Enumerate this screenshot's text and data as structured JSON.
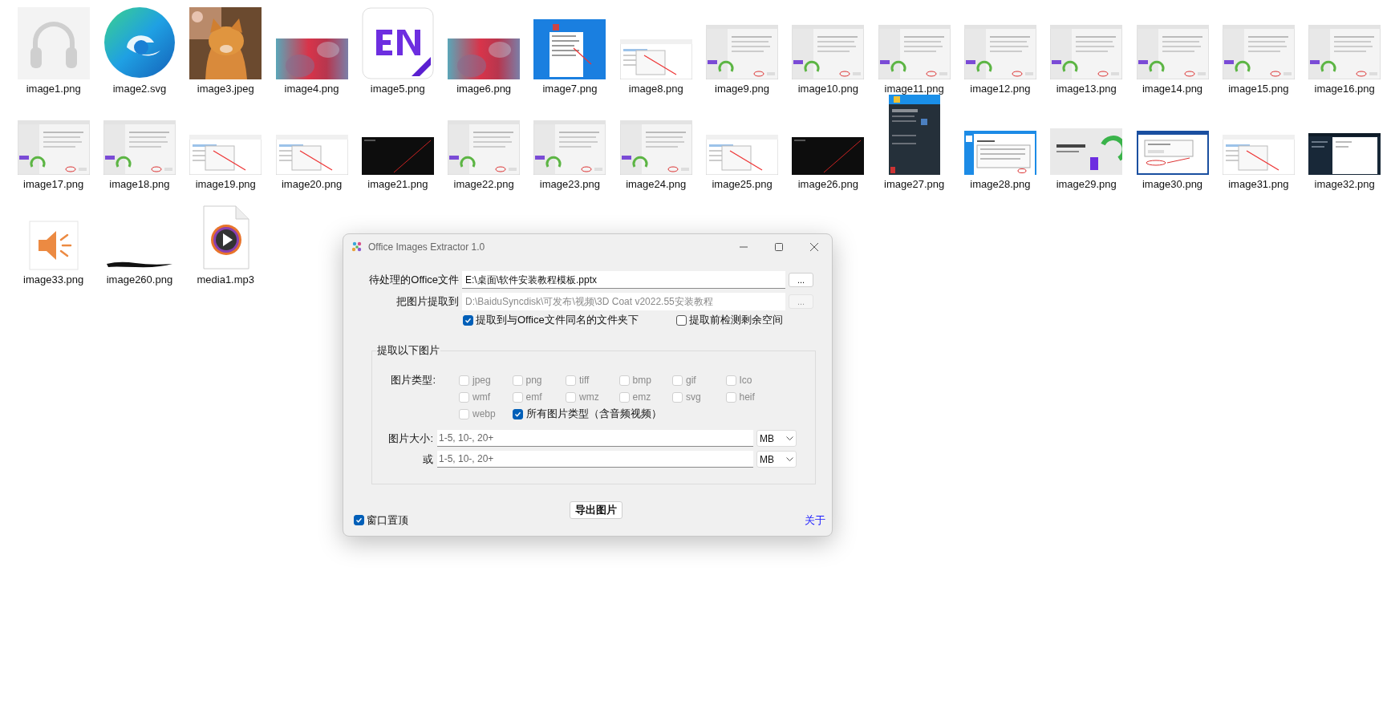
{
  "files": [
    {
      "name": "image1.png",
      "kind": "audio"
    },
    {
      "name": "image2.svg",
      "kind": "swirl"
    },
    {
      "name": "image3.jpeg"
    },
    {
      "name": "image4.png",
      "kind": "gradient"
    },
    {
      "name": "image5.png",
      "kind": "logo"
    },
    {
      "name": "image6.png",
      "kind": "gradient"
    },
    {
      "name": "image7.png",
      "kind": "desktop"
    },
    {
      "name": "image8.png",
      "kind": "explorer"
    },
    {
      "name": "image9.png",
      "kind": "installer"
    },
    {
      "name": "image10.png",
      "kind": "installer"
    },
    {
      "name": "image11.png",
      "kind": "installer"
    },
    {
      "name": "image12.png",
      "kind": "installer"
    },
    {
      "name": "image13.png",
      "kind": "installer"
    },
    {
      "name": "image14.png",
      "kind": "installer"
    },
    {
      "name": "image15.png",
      "kind": "installer"
    },
    {
      "name": "image16.png",
      "kind": "installer"
    },
    {
      "name": "image17.png",
      "kind": "installer"
    },
    {
      "name": "image18.png",
      "kind": "installer"
    },
    {
      "name": "image19.png",
      "kind": "explorer"
    },
    {
      "name": "image20.png",
      "kind": "explorer"
    },
    {
      "name": "image21.png",
      "kind": "dark"
    },
    {
      "name": "image22.png",
      "kind": "installer"
    },
    {
      "name": "image23.png",
      "kind": "installer"
    },
    {
      "name": "image24.png",
      "kind": "installer"
    },
    {
      "name": "image25.png",
      "kind": "explorer"
    },
    {
      "name": "image26.png",
      "kind": "dark"
    },
    {
      "name": "image27.png",
      "kind": "darkapp"
    },
    {
      "name": "image28.png",
      "kind": "bluedialog"
    },
    {
      "name": "image29.png",
      "kind": "splash"
    },
    {
      "name": "image30.png",
      "kind": "bluewindow"
    },
    {
      "name": "image31.png",
      "kind": "explorer"
    },
    {
      "name": "image32.png",
      "kind": "darkwindow"
    },
    {
      "name": "image33.png",
      "kind": "speaker"
    },
    {
      "name": "image260.png",
      "kind": "scribble"
    },
    {
      "name": "media1.mp3",
      "kind": "media"
    }
  ],
  "dialog": {
    "title": "Office Images Extractor 1.0",
    "source": {
      "label": "待处理的Office文件",
      "value": "E:\\桌面\\软件安装教程模板.pptx",
      "browse": "...",
      "disabled": false
    },
    "target": {
      "label": "把图片提取到",
      "value": "D:\\BaiduSyncdisk\\可发布\\视频\\3D Coat v2022.55安装教程",
      "browse": "...",
      "disabled": true
    },
    "options": [
      {
        "label": "提取到与Office文件同名的文件夹下",
        "checked": true
      },
      {
        "label": "提取前检测剩余空间",
        "checked": false
      }
    ],
    "group": {
      "title": "提取以下图片",
      "types_label": "图片类型:",
      "types": [
        {
          "label": "jpeg",
          "checked": false,
          "disabled": true
        },
        {
          "label": "png",
          "checked": false,
          "disabled": true
        },
        {
          "label": "tiff",
          "checked": false,
          "disabled": true
        },
        {
          "label": "bmp",
          "checked": false,
          "disabled": true
        },
        {
          "label": "gif",
          "checked": false,
          "disabled": true
        },
        {
          "label": "Ico",
          "checked": false,
          "disabled": true
        },
        {
          "label": "wmf",
          "checked": false,
          "disabled": true
        },
        {
          "label": "emf",
          "checked": false,
          "disabled": true
        },
        {
          "label": "wmz",
          "checked": false,
          "disabled": true
        },
        {
          "label": "emz",
          "checked": false,
          "disabled": true
        },
        {
          "label": "svg",
          "checked": false,
          "disabled": true
        },
        {
          "label": "heif",
          "checked": false,
          "disabled": true
        },
        {
          "label": "webp",
          "checked": false,
          "disabled": true
        },
        {
          "label": "所有图片类型（含音频视频）",
          "checked": true,
          "disabled": false
        }
      ],
      "sizes": [
        {
          "label": "图片大小:",
          "placeholder": "1-5, 10-, 20+",
          "unit": "MB"
        },
        {
          "label": "或",
          "placeholder": "1-5, 10-, 20+",
          "unit": "MB"
        }
      ]
    },
    "export_button": "导出图片",
    "topmost": {
      "label": "窗口置顶",
      "checked": true
    },
    "about_link": "关于"
  }
}
